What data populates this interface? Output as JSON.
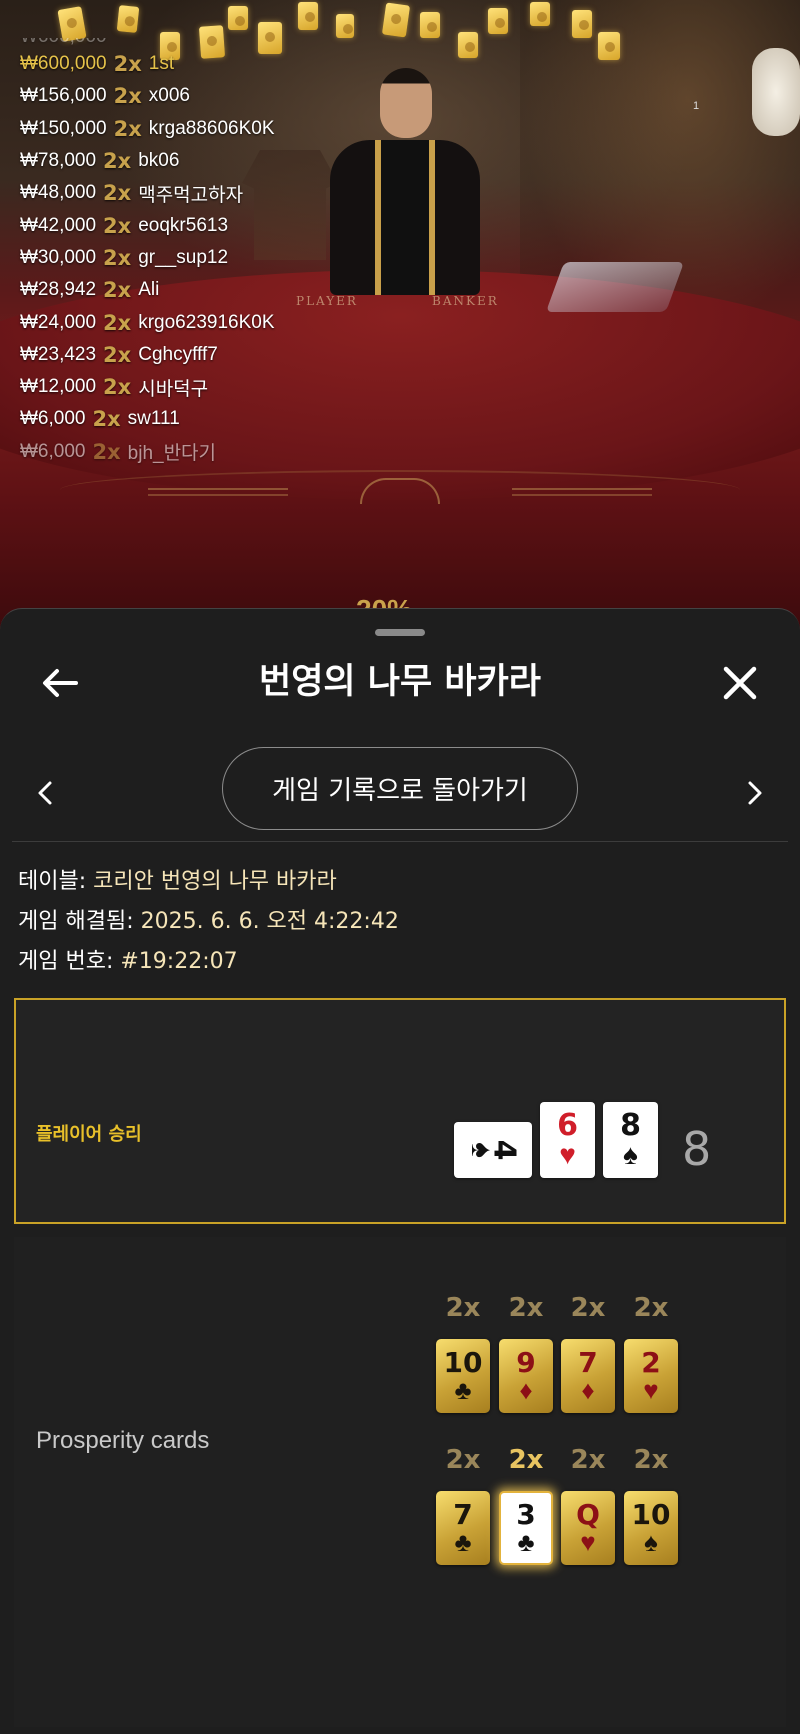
{
  "leaderboard": [
    {
      "amount": "₩600,000",
      "mult": "2x",
      "name": "1st"
    },
    {
      "amount": "₩156,000",
      "mult": "2x",
      "name": "x006"
    },
    {
      "amount": "₩150,000",
      "mult": "2x",
      "name": "krga88606K0K"
    },
    {
      "amount": "₩78,000",
      "mult": "2x",
      "name": "bk06"
    },
    {
      "amount": "₩48,000",
      "mult": "2x",
      "name": "맥주먹고하자"
    },
    {
      "amount": "₩42,000",
      "mult": "2x",
      "name": "eoqkr5613"
    },
    {
      "amount": "₩30,000",
      "mult": "2x",
      "name": "gr__sup12"
    },
    {
      "amount": "₩28,942",
      "mult": "2x",
      "name": "Ali"
    },
    {
      "amount": "₩24,000",
      "mult": "2x",
      "name": "krgo623916K0K"
    },
    {
      "amount": "₩23,423",
      "mult": "2x",
      "name": "Cghcyfff7"
    },
    {
      "amount": "₩12,000",
      "mult": "2x",
      "name": "시바덕구"
    },
    {
      "amount": "₩6,000",
      "mult": "2x",
      "name": "sw111"
    },
    {
      "amount": "₩6,000",
      "mult": "2x",
      "name": "bjh_반다기"
    }
  ],
  "video": {
    "felt_player": "PLAYER",
    "felt_banker": "BANKER",
    "corner_badge": "1"
  },
  "sheet": {
    "title": "번영의 나무 바카라",
    "history_button": "게임 기록으로 돌아가기",
    "icons": {
      "back": "arrow-left-icon",
      "close": "close-icon",
      "prev": "chevron-left-icon",
      "next": "chevron-right-icon"
    }
  },
  "details": {
    "table_label": "테이블: ",
    "table_value": "코리안 번영의 나무 바카라",
    "resolved_label": "게임 해결됨: ",
    "resolved_value": "2025. 6. 6. 오전 4:22:42",
    "number_label": "게임 번호: ",
    "number_value": "#19:22:07"
  },
  "result": {
    "label": "플레이어 승리",
    "score": "8",
    "cards": [
      {
        "rank": "4",
        "suit": "♠",
        "color": "black",
        "orientation": "sideways"
      },
      {
        "rank": "6",
        "suit": "♥",
        "color": "red",
        "orientation": "upright"
      },
      {
        "rank": "8",
        "suit": "♠",
        "color": "black",
        "orientation": "upright"
      }
    ]
  },
  "prosperity": {
    "label": "Prosperity cards",
    "rows": [
      [
        {
          "mult": "2x",
          "rank": "10",
          "suit": "♣",
          "color": "black",
          "highlight": false
        },
        {
          "mult": "2x",
          "rank": "9",
          "suit": "♦",
          "color": "red",
          "highlight": false
        },
        {
          "mult": "2x",
          "rank": "7",
          "suit": "♦",
          "color": "red",
          "highlight": false
        },
        {
          "mult": "2x",
          "rank": "2",
          "suit": "♥",
          "color": "red",
          "highlight": false
        }
      ],
      [
        {
          "mult": "2x",
          "rank": "7",
          "suit": "♣",
          "color": "black",
          "highlight": false
        },
        {
          "mult": "2x",
          "rank": "3",
          "suit": "♣",
          "color": "black",
          "highlight": true
        },
        {
          "mult": "2x",
          "rank": "Q",
          "suit": "♥",
          "color": "red",
          "highlight": false
        },
        {
          "mult": "2x",
          "rank": "10",
          "suit": "♠",
          "color": "black",
          "highlight": false
        }
      ]
    ]
  },
  "colors": {
    "accent_gold": "#c9a227",
    "sheet_bg": "#1e1e1e",
    "value_text": "#f6e5b8"
  }
}
